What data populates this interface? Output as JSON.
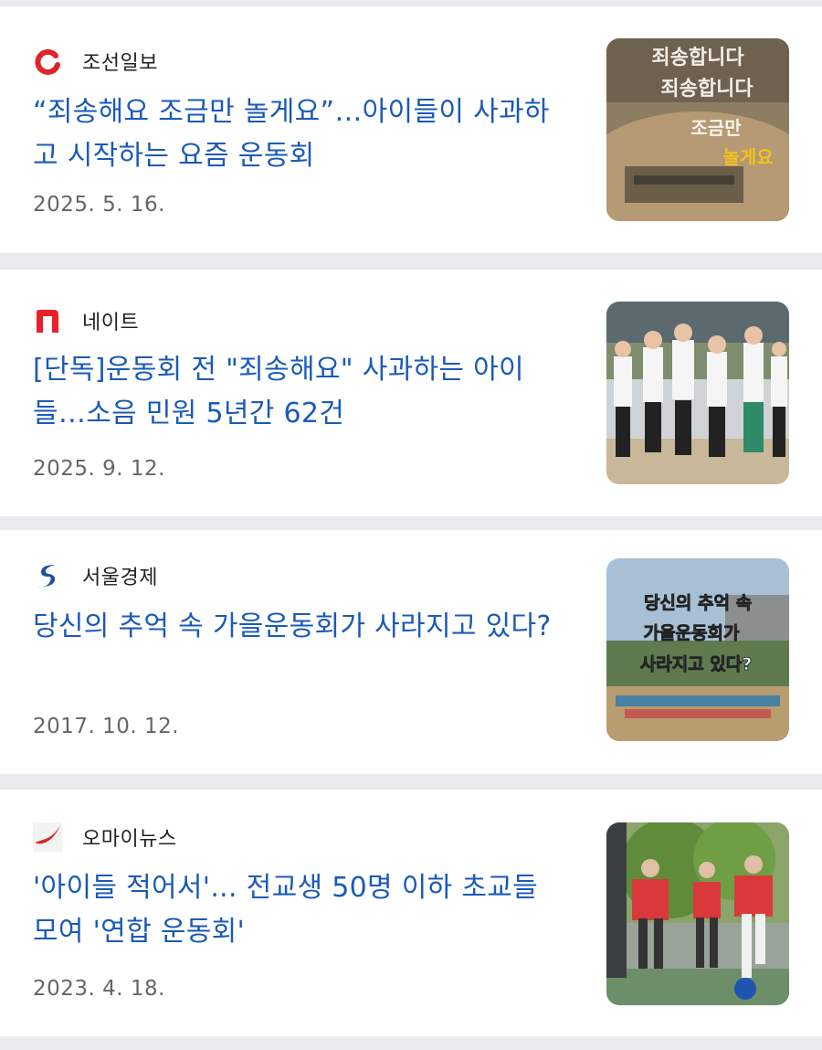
{
  "articles": [
    {
      "source": "조선일보",
      "source_logo_icon": "chosun-logo-icon",
      "title": "“죄송해요 조금만 놀게요”…아이들이 사과하고 시작하는 요즘 운동회",
      "date": "2025. 5. 16.",
      "thumb_overlay": [
        "죄송합니다",
        "죄송합니다",
        "조금만",
        "놀게요"
      ]
    },
    {
      "source": "네이트",
      "source_logo_icon": "nate-logo-icon",
      "title": "[단독]운동회 전 \"죄송해요\" 사과하는 아이들…소음 민원 5년간 62건",
      "date": "2025. 9. 12."
    },
    {
      "source": "서울경제",
      "source_logo_icon": "sedaily-logo-icon",
      "title": "당신의 추억 속 가을운동회가 사라지고 있다?",
      "date": "2017. 10. 12.",
      "thumb_overlay": [
        "당신의 추억 속",
        "가을운동회가",
        "사라지고 있다?"
      ]
    },
    {
      "source": "오마이뉴스",
      "source_logo_icon": "ohmynews-logo-icon",
      "title": "'아이들 적어서'... 전교생 50명 이하 초교들 모여 '연합 운동회'",
      "date": "2023. 4. 18."
    }
  ],
  "colors": {
    "title": "#1a5ab8",
    "separator": "#e9eaed",
    "chosun_red": "#e0242b",
    "nate_red": "#e8202a",
    "sedaily_blue": "#1d4fa3",
    "ohmynews_red": "#d7262b"
  }
}
